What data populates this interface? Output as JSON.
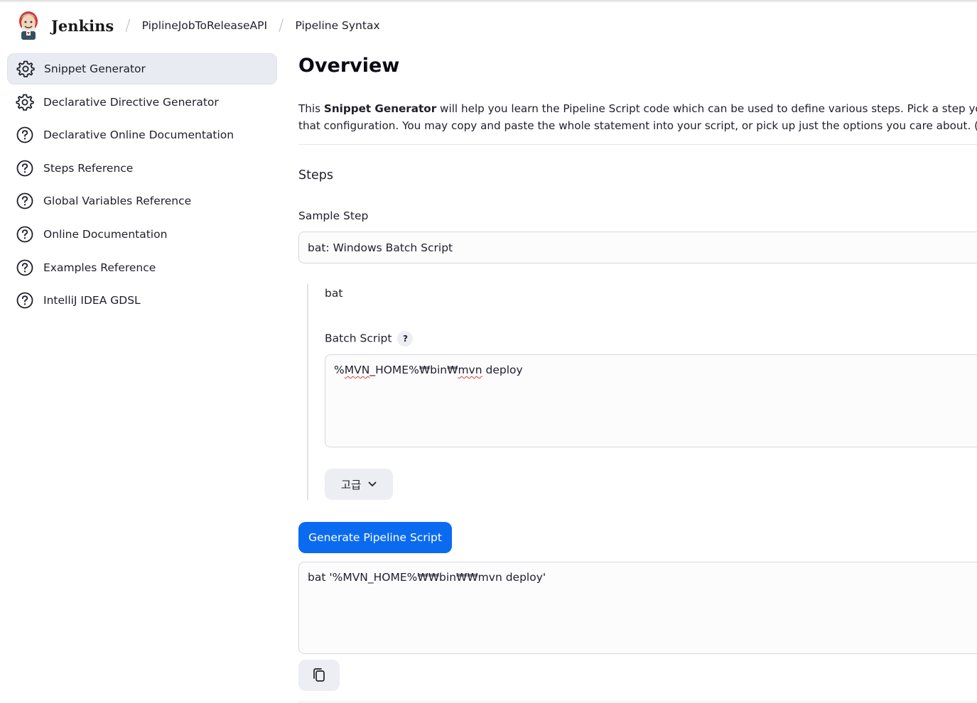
{
  "header": {
    "brand": "Jenkins",
    "breadcrumbs": [
      "PiplineJobToReleaseAPI",
      "Pipeline Syntax"
    ],
    "separator": "/"
  },
  "sidebar": {
    "items": [
      {
        "label": "Snippet Generator",
        "icon": "gear-icon",
        "active": true
      },
      {
        "label": "Declarative Directive Generator",
        "icon": "gear-icon",
        "active": false
      },
      {
        "label": "Declarative Online Documentation",
        "icon": "help-circle-icon",
        "active": false
      },
      {
        "label": "Steps Reference",
        "icon": "help-circle-icon",
        "active": false
      },
      {
        "label": "Global Variables Reference",
        "icon": "help-circle-icon",
        "active": false
      },
      {
        "label": "Online Documentation",
        "icon": "help-circle-icon",
        "active": false
      },
      {
        "label": "Examples Reference",
        "icon": "help-circle-icon",
        "active": false
      },
      {
        "label": "IntelliJ IDEA GDSL",
        "icon": "help-circle-icon",
        "active": false
      }
    ]
  },
  "main": {
    "title": "Overview",
    "description": {
      "line1_pre": "This ",
      "line1_bold": "Snippet Generator",
      "line1_post": " will help you learn the Pipeline Script code which can be used to define various steps. Pick a step you a",
      "line2": "that configuration. You may copy and paste the whole statement into your script, or pick up just the options you care about. (M"
    },
    "steps_title": "Steps",
    "sample_step_label": "Sample Step",
    "sample_step_value": "bat: Windows Batch Script",
    "step_name": "bat",
    "batch_script_label": "Batch Script",
    "help_badge": "?",
    "batch_script_parts": [
      "%",
      "MVN",
      "_HOME%₩bin₩",
      "mvn",
      " deploy"
    ],
    "advanced_label": "고급",
    "generate_button": "Generate Pipeline Script",
    "generated_script": "bat '%MVN_HOME%₩₩bin₩₩mvn deploy'"
  },
  "colors": {
    "primary_button": "#0b6bf0",
    "active_sidebar_bg": "#e9ebf2",
    "spellcheck_underline": "#e03a3a"
  }
}
